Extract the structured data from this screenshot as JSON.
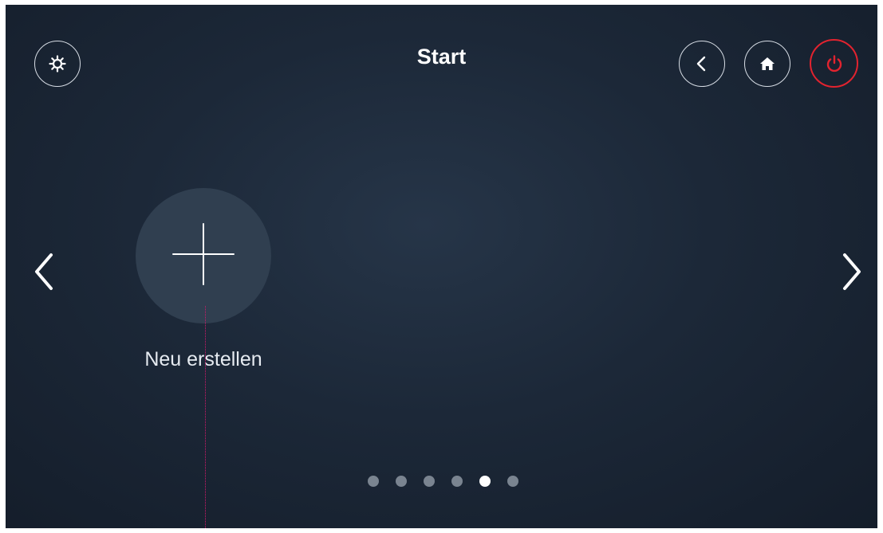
{
  "header": {
    "title": "Start"
  },
  "toolbar": {
    "settings_icon": "gear-icon",
    "back_icon": "chevron-left-icon",
    "home_icon": "home-icon",
    "power_icon": "power-icon",
    "power_color": "#e2232f"
  },
  "main": {
    "create_tile": {
      "icon": "plus-icon",
      "label": "Neu erstellen"
    },
    "prev_icon": "chevron-left-icon",
    "next_icon": "chevron-right-icon"
  },
  "pagination": {
    "pages": 6,
    "active_page": 5
  },
  "colors": {
    "background": "#1c2838",
    "tile": "#303f50",
    "accent": "#e2232f",
    "dot_inactive": "#7a8490",
    "dot_active": "#ffffff"
  }
}
